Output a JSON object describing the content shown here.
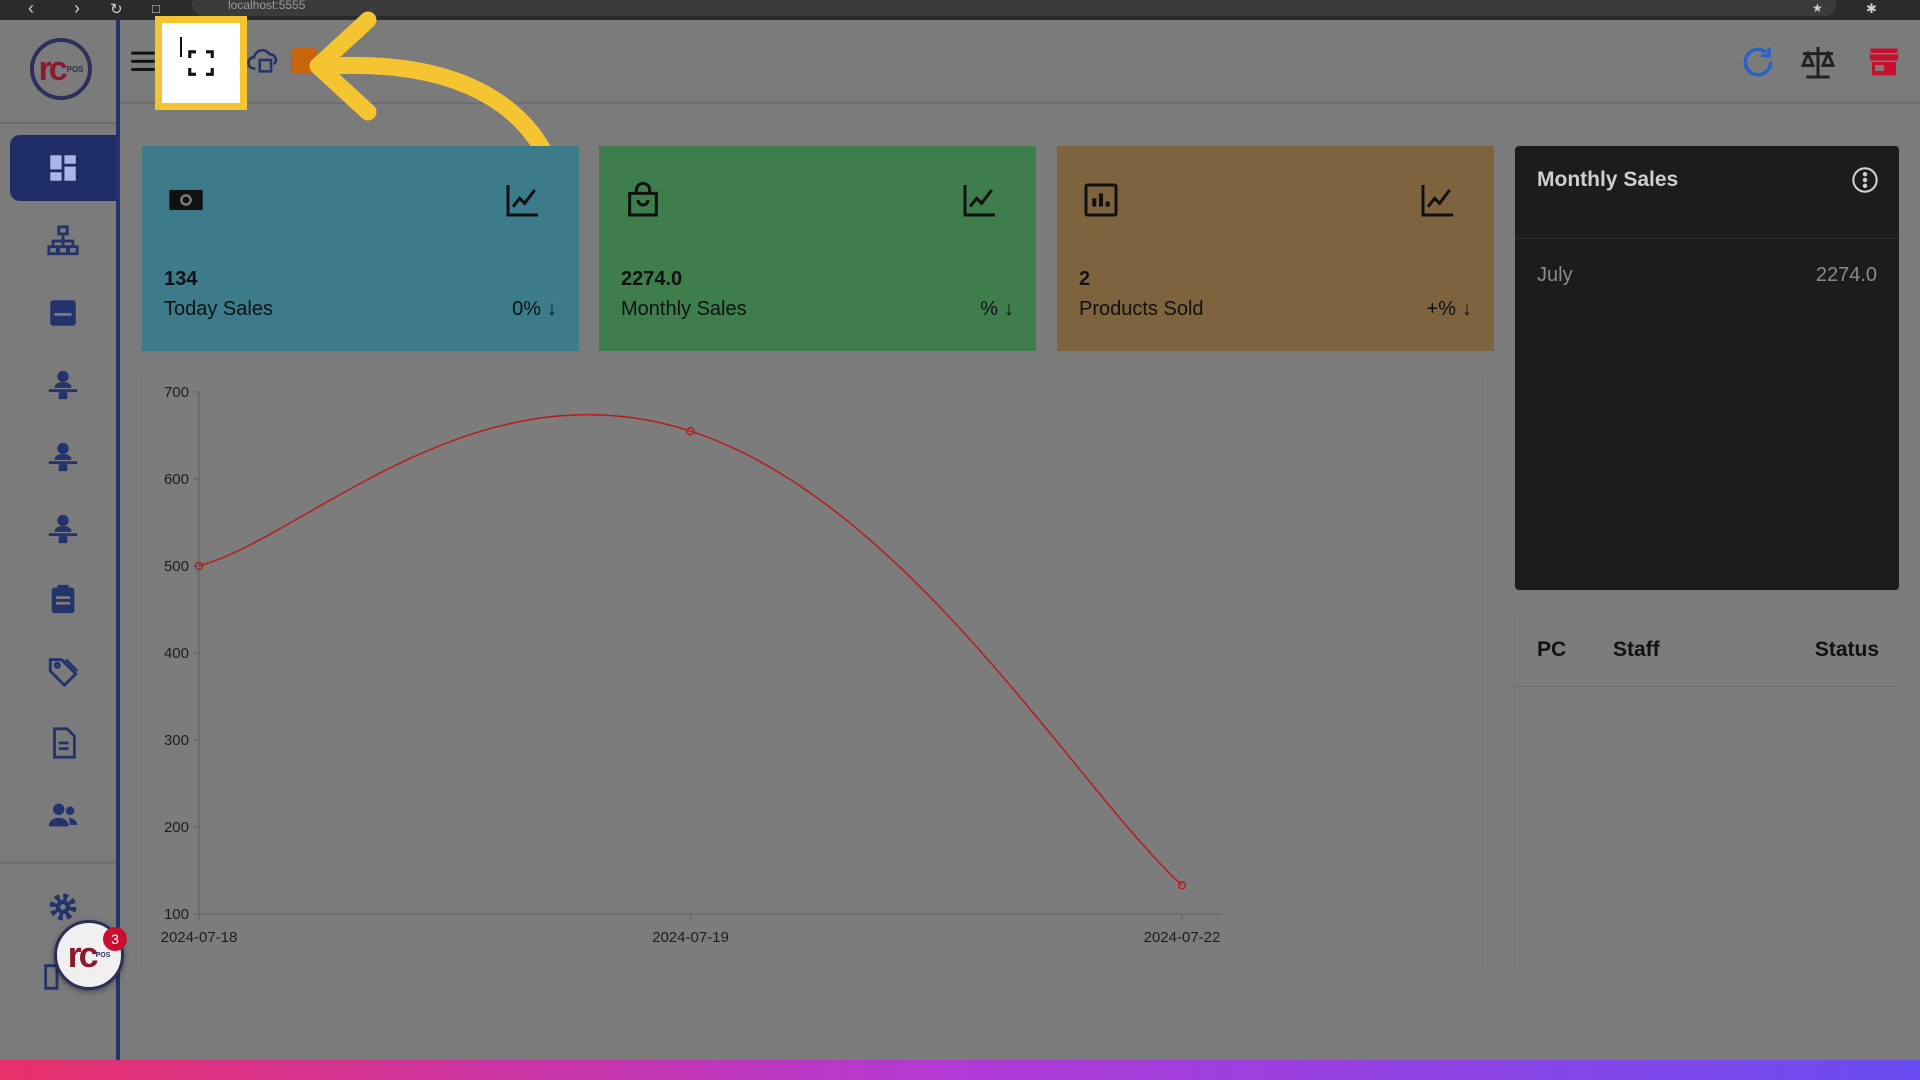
{
  "browser": {
    "url": "localhost:5555"
  },
  "app": {
    "logo_text": "rc",
    "logo_sub": "POS",
    "notification_count": "3"
  },
  "cards": [
    {
      "value": "134",
      "label": "Today Sales",
      "change": "0%",
      "color": "#3b7b8a",
      "icon": "money-icon"
    },
    {
      "value": "2274.0",
      "label": "Monthly Sales",
      "change": "%",
      "color": "#3d7e4c",
      "icon": "shopping-bag-icon"
    },
    {
      "value": "2",
      "label": "Products Sold",
      "change": "+%",
      "color": "#7e633f",
      "icon": "bar-chart-icon"
    }
  ],
  "monthly_sales": {
    "title": "Monthly Sales",
    "rows": [
      {
        "month": "July",
        "amount": "2274.0"
      }
    ]
  },
  "table": {
    "headers": [
      "PC",
      "Staff",
      "Status"
    ]
  },
  "chart_data": {
    "type": "line",
    "x": [
      "2024-07-18",
      "2024-07-19",
      "2024-07-22"
    ],
    "series": [
      {
        "values": [
          500,
          655,
          133
        ],
        "color": "#b22222"
      }
    ],
    "ylim": [
      100,
      700
    ],
    "yticks": [
      100,
      200,
      300,
      400,
      500,
      600,
      700
    ],
    "grid": false
  }
}
